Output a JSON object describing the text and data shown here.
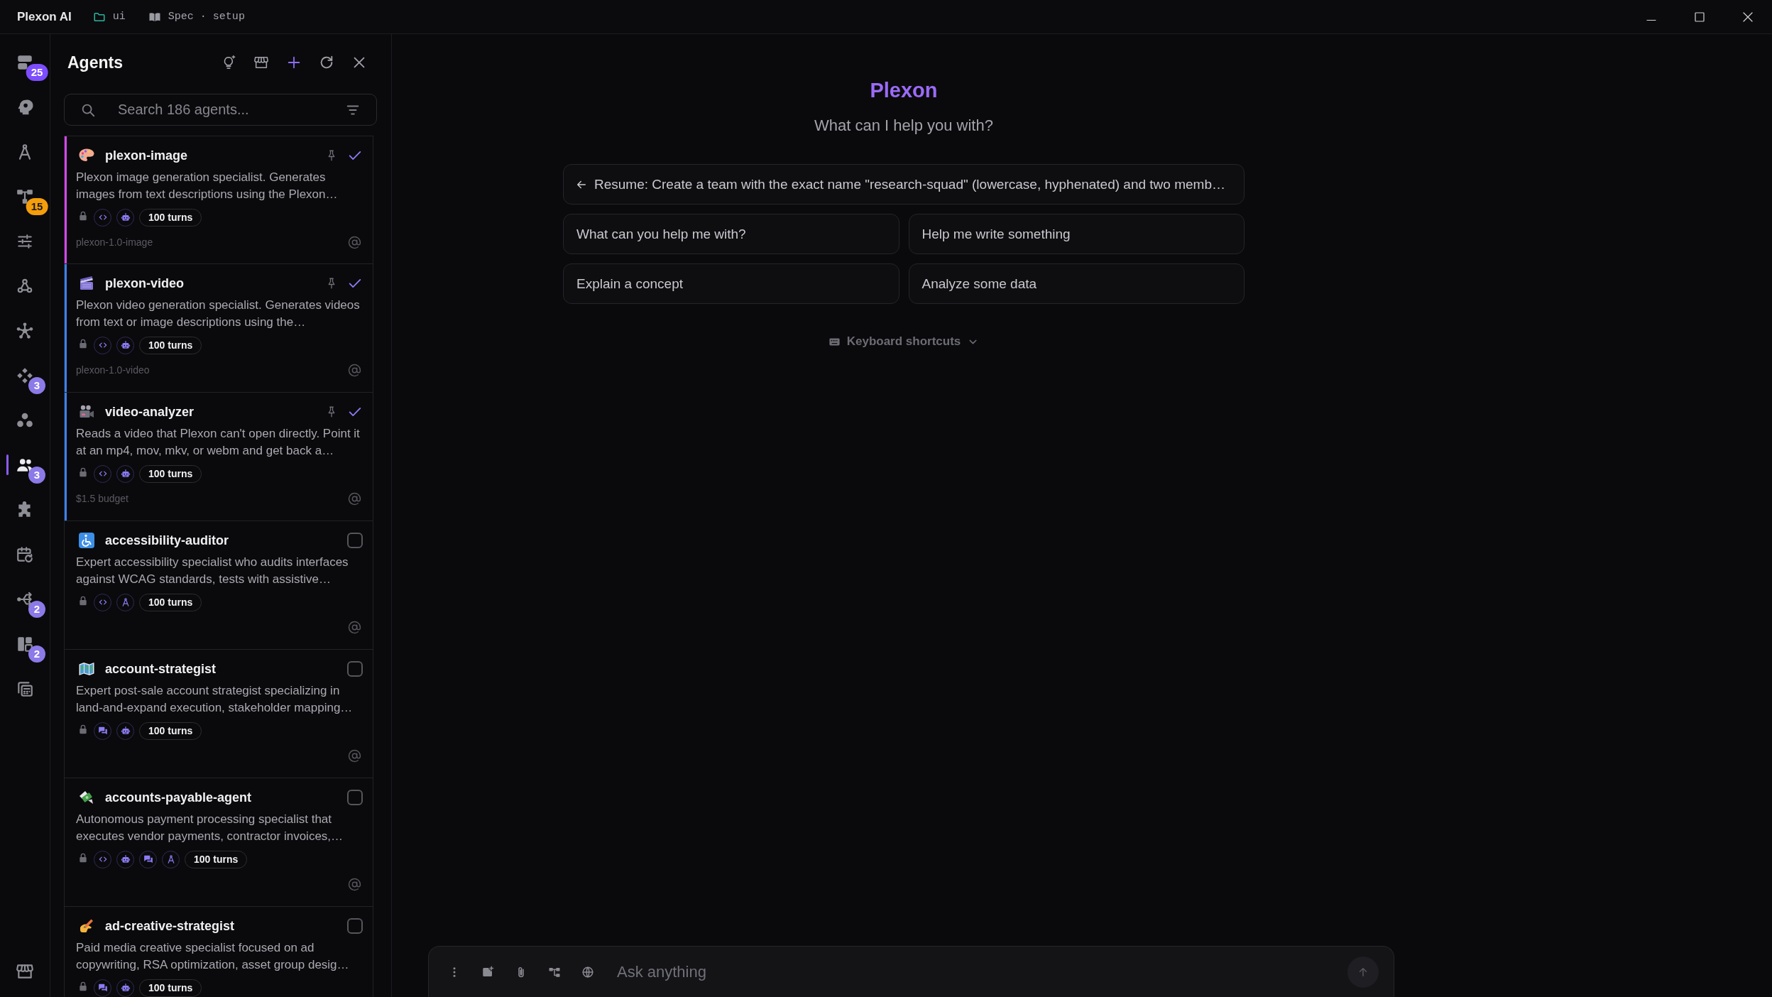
{
  "title_bar": {
    "app_name": "Plexon AI",
    "folder": "ui",
    "document": "Spec · setup"
  },
  "rail": {
    "items": [
      {
        "selected": false,
        "badge": {
          "count": "25",
          "color": "#7c4dff"
        }
      },
      {
        "selected": false
      },
      {
        "selected": false
      },
      {
        "selected": false,
        "badge": {
          "count": "15",
          "color": "#f59e0b"
        }
      },
      {
        "selected": false
      },
      {
        "selected": false
      },
      {
        "selected": false
      },
      {
        "selected": false,
        "badge": {
          "count": "3",
          "color": "#8b7ae8"
        }
      },
      {
        "selected": false
      },
      {
        "selected": true,
        "badge": {
          "count": "3",
          "color": "#8b7ae8"
        }
      },
      {
        "selected": false
      },
      {
        "selected": false
      },
      {
        "selected": false,
        "badge": {
          "count": "2",
          "color": "#8b7ae8"
        }
      },
      {
        "selected": false,
        "badge": {
          "count": "2",
          "color": "#8b7ae8"
        }
      },
      {
        "selected": false
      }
    ],
    "bottom_items": [
      {
        "selected": false
      }
    ]
  },
  "agents_panel": {
    "title": "Agents",
    "search": {
      "placeholder": "Search 186 agents..."
    },
    "items": [
      {
        "name": "plexon-image",
        "description": "Plexon image generation specialist. Generates images from text descriptions using the Plexon…",
        "selected": true,
        "color": "#d946ef",
        "capabilities": [
          {
            "kind": "code"
          },
          {
            "kind": "robot"
          }
        ],
        "turns": "100 turns",
        "footer": "plexon-1.0-image"
      },
      {
        "name": "plexon-video",
        "description": "Plexon video generation specialist. Generates videos from text or image descriptions using the…",
        "selected": true,
        "color": "#3b82f6",
        "capabilities": [
          {
            "kind": "code"
          },
          {
            "kind": "robot"
          }
        ],
        "turns": "100 turns",
        "footer": "plexon-1.0-video"
      },
      {
        "name": "video-analyzer",
        "description": "Reads a video that Plexon can't open directly. Point it at an mp4, mov, mkv, or webm and get back a…",
        "selected": true,
        "color": "#3b82f6",
        "capabilities": [
          {
            "kind": "code"
          },
          {
            "kind": "robot"
          }
        ],
        "turns": "100 turns",
        "footer": "$1.5 budget"
      },
      {
        "name": "accessibility-auditor",
        "description": "Expert accessibility specialist who audits interfaces against WCAG standards, tests with assistive…",
        "selected": false,
        "capabilities": [
          {
            "kind": "code"
          },
          {
            "kind": "compass"
          }
        ],
        "turns": "100 turns"
      },
      {
        "name": "account-strategist",
        "description": "Expert post-sale account strategist specializing in land-and-expand execution, stakeholder mapping…",
        "selected": false,
        "capabilities": [
          {
            "kind": "chat"
          },
          {
            "kind": "robot"
          }
        ],
        "turns": "100 turns"
      },
      {
        "name": "accounts-payable-agent",
        "description": "Autonomous payment processing specialist that executes vendor payments, contractor invoices,…",
        "selected": false,
        "capabilities": [
          {
            "kind": "code"
          },
          {
            "kind": "robot"
          },
          {
            "kind": "chat"
          },
          {
            "kind": "compass"
          }
        ],
        "turns": "100 turns"
      },
      {
        "name": "ad-creative-strategist",
        "description": "Paid media creative specialist focused on ad copywriting, RSA optimization, asset group desig…",
        "selected": false,
        "capabilities": [
          {
            "kind": "chat"
          },
          {
            "kind": "robot"
          }
        ],
        "turns": "100 turns"
      }
    ]
  },
  "main": {
    "title": "Plexon",
    "subtitle": "What can I help you with?",
    "resume": "Resume: Create a team with the exact name \"research-squad\" (lowercase, hyphenated) and two memb…",
    "suggestions": [
      "What can you help me with?",
      "Help me write something",
      "Explain a concept",
      "Analyze some data"
    ],
    "shortcuts": {
      "label": "Keyboard shortcuts",
      "expanded": false
    }
  },
  "composer": {
    "placeholder": "Ask anything"
  }
}
